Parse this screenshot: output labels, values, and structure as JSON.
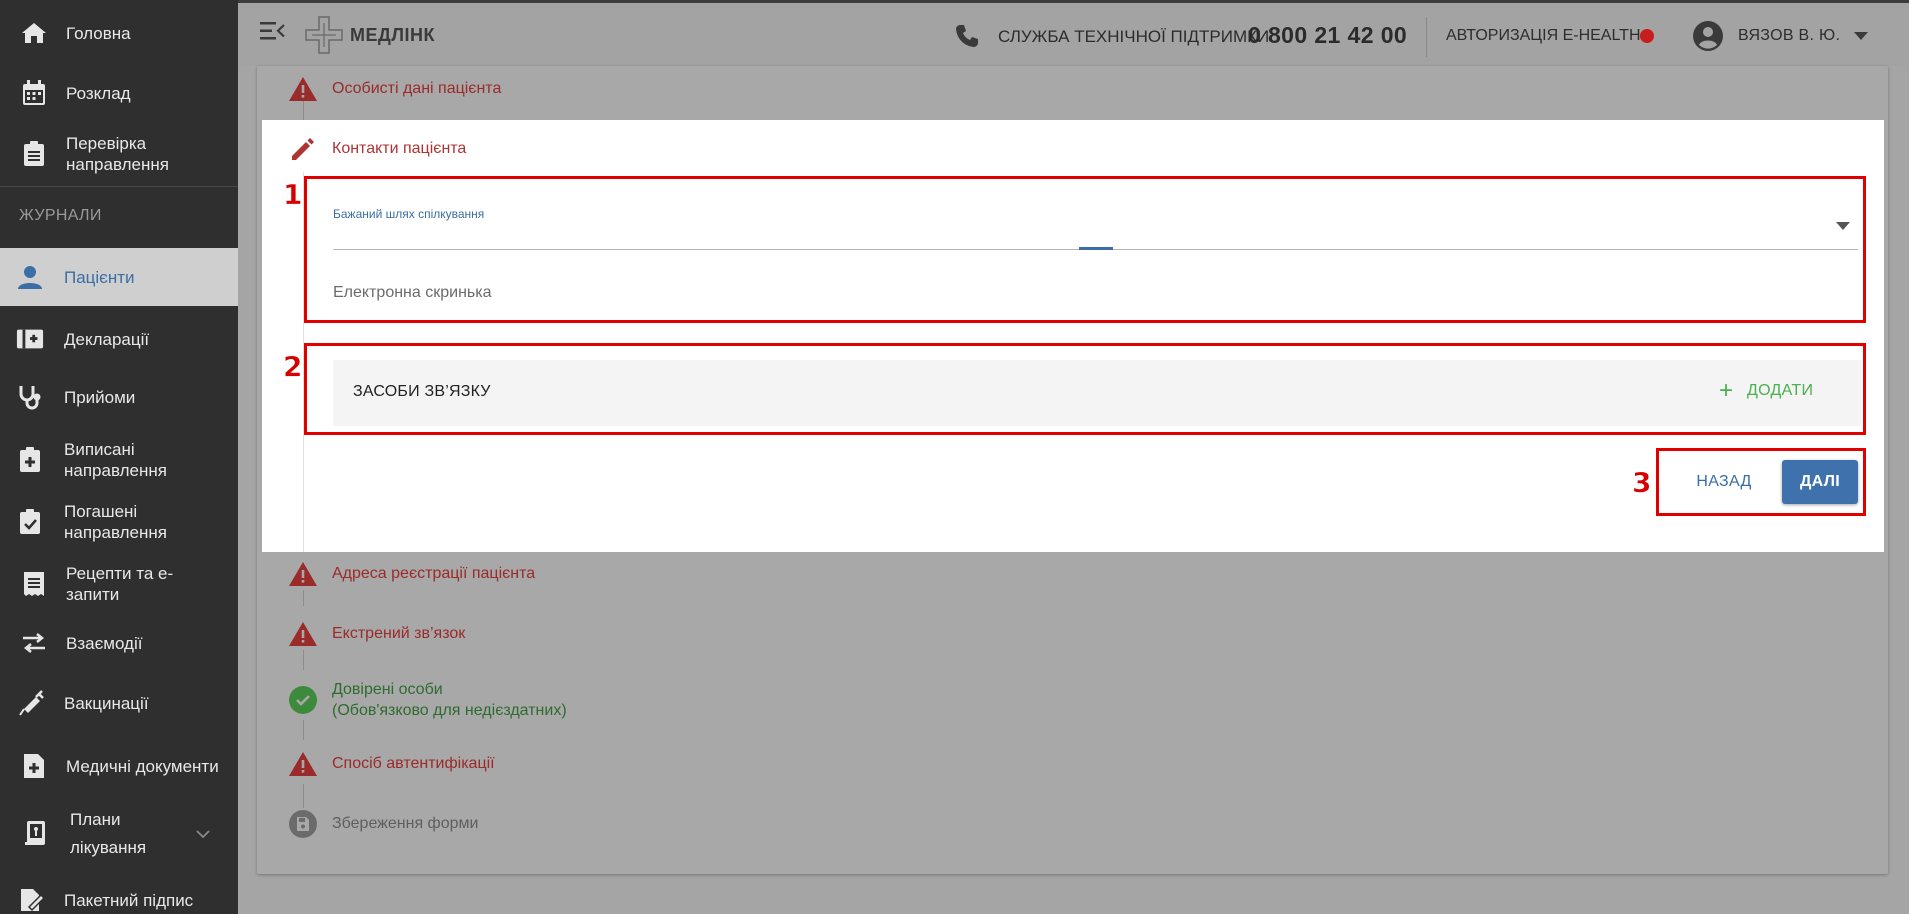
{
  "colors": {
    "sidebar_bg": "#2f2f2f",
    "accent_blue": "#3f72ad",
    "error_red": "#b03333",
    "success_green": "#4caf50",
    "annotation_red": "#e00000"
  },
  "sidebar": {
    "items_top": [
      {
        "label": "Головна",
        "icon": "home-icon"
      },
      {
        "label": "Розклад",
        "icon": "calendar-icon"
      },
      {
        "label": "Перевірка направлення",
        "icon": "clipboard-list-icon"
      }
    ],
    "section_label": "ЖУРНАЛИ",
    "items_journal": [
      {
        "label": "Пацієнти",
        "icon": "person-icon",
        "active": true
      },
      {
        "label": "Декларації",
        "icon": "medical-folder-icon"
      },
      {
        "label": "Прийоми",
        "icon": "stethoscope-icon"
      },
      {
        "label": "Виписані направлення",
        "icon": "clipboard-plus-icon"
      },
      {
        "label": "Погашені направлення",
        "icon": "clipboard-check-icon"
      },
      {
        "label": "Рецепти та е-запити",
        "icon": "receipt-icon"
      },
      {
        "label": "Взаємодії",
        "icon": "swap-arrows-icon"
      },
      {
        "label": "Вакцинації",
        "icon": "syringe-icon"
      },
      {
        "label": "Медичні документи",
        "icon": "medical-document-icon"
      },
      {
        "label": "Плани лікування",
        "icon": "treatment-plan-icon"
      },
      {
        "label": "Пакетний підпис",
        "icon": "signature-icon"
      }
    ]
  },
  "topbar": {
    "brand": "МЕДЛІНК",
    "support_label": "СЛУЖБА ТЕХНІЧНОЇ ПІДТРИМКИ",
    "support_phone": "0 800 21 42 00",
    "ehealth_label": "АВТОРИЗАЦІЯ E-HEALTH",
    "ehealth_status_color": "#c91c1c",
    "user_name": "ВЯЗОВ В. Ю."
  },
  "steps": {
    "personal": {
      "label": "Особисті дані пацієнта",
      "status": "error"
    },
    "contacts": {
      "label": "Контакти пацієнта",
      "status": "editing"
    },
    "address": {
      "label": "Адреса реєстрації пацієнта",
      "status": "error"
    },
    "emergency": {
      "label": "Екстрений зв’язок",
      "status": "error"
    },
    "trusted": {
      "label": "Довірені особи",
      "sublabel": "(Обов'язково для недієздатних)",
      "status": "ok"
    },
    "auth": {
      "label": "Спосіб автентифікації",
      "status": "error"
    },
    "save": {
      "label": "Збереження форми",
      "status": "disabled"
    }
  },
  "contacts_form": {
    "preferred_way_label": "Бажаний шлях спілкування",
    "preferred_way_value": "",
    "email_placeholder": "Електронна скринька",
    "means_title": "ЗАСОБИ ЗВ’ЯЗКУ",
    "add_label": "ДОДАТИ",
    "back_label": "НАЗАД",
    "next_label": "ДАЛІ"
  },
  "annotations": [
    "1",
    "2",
    "3"
  ]
}
